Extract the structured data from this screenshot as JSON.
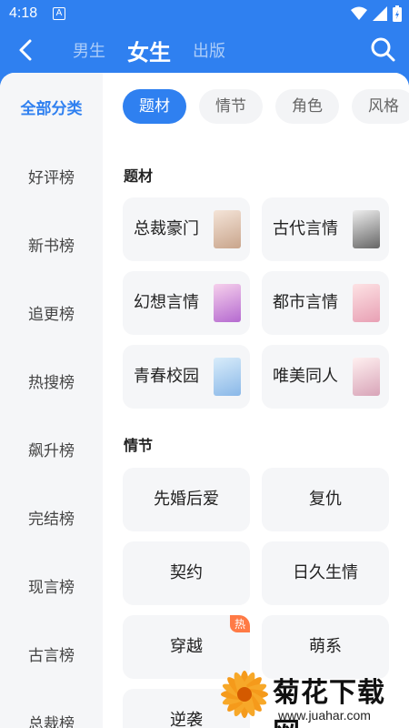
{
  "statusbar": {
    "time": "4:18",
    "notification": "A"
  },
  "header": {
    "tabs": [
      {
        "label": "男生",
        "active": false
      },
      {
        "label": "女生",
        "active": true
      },
      {
        "label": "出版",
        "active": false
      }
    ]
  },
  "sidebar": {
    "items": [
      {
        "label": "全部分类",
        "active": true
      },
      {
        "label": "好评榜"
      },
      {
        "label": "新书榜"
      },
      {
        "label": "追更榜"
      },
      {
        "label": "热搜榜"
      },
      {
        "label": "飙升榜"
      },
      {
        "label": "完结榜"
      },
      {
        "label": "现言榜"
      },
      {
        "label": "古言榜"
      },
      {
        "label": "总裁榜"
      }
    ]
  },
  "filters": {
    "chips": [
      {
        "label": "题材",
        "active": true
      },
      {
        "label": "情节"
      },
      {
        "label": "角色"
      },
      {
        "label": "风格"
      }
    ]
  },
  "sections": {
    "theme": {
      "title": "题材",
      "cards": [
        {
          "label": "总裁豪门"
        },
        {
          "label": "古代言情"
        },
        {
          "label": "幻想言情"
        },
        {
          "label": "都市言情"
        },
        {
          "label": "青春校园"
        },
        {
          "label": "唯美同人"
        }
      ]
    },
    "plot": {
      "title": "情节",
      "cards": [
        {
          "label": "先婚后爱"
        },
        {
          "label": "复仇"
        },
        {
          "label": "契约"
        },
        {
          "label": "日久生情"
        },
        {
          "label": "穿越",
          "badge": "热"
        },
        {
          "label": "萌系"
        },
        {
          "label": "逆袭"
        }
      ]
    }
  },
  "watermark": {
    "title": "菊花下载网",
    "url": "www.juahar.com"
  },
  "colors": {
    "primary": "#2f80f0",
    "hot": "#ff7a45",
    "card_bg": "#f5f6f8"
  }
}
